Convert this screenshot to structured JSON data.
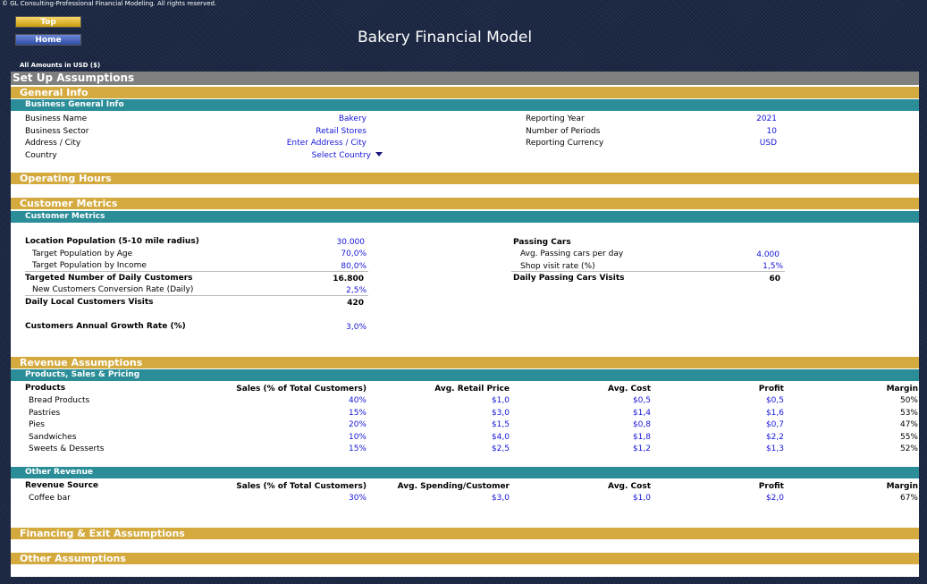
{
  "copyright": "© GL Consulting-Professional Financial Modeling. All rights reserved.",
  "nav": {
    "top_label": "Top",
    "home_label": "Home"
  },
  "title": "Bakery Financial Model",
  "amounts_note": "All Amounts in  USD ($)",
  "setup_title": "Set Up Assumptions",
  "general": {
    "section": "General Info",
    "sub": "Business General Info",
    "business_name_label": "Business Name",
    "business_name": "Bakery",
    "sector_label": "Business Sector",
    "sector": "Retail Stores",
    "address_label": "Address / City",
    "address": "Enter Address / City",
    "country_label": "Country",
    "country": "Select Country",
    "reporting_year_label": "Reporting Year",
    "reporting_year": "2021",
    "periods_label": "Number of Periods",
    "periods": "10",
    "currency_label": "Reporting Currency",
    "currency": "USD"
  },
  "operating_hours": {
    "section": "Operating Hours"
  },
  "customer": {
    "section": "Customer Metrics",
    "sub": "Customer Metrics",
    "pop_label": "Location Population (5-10 mile radius)",
    "pop": "30.000",
    "age_label": "Target Population by Age",
    "age": "70,0%",
    "income_label": "Target Population by Income",
    "income": "80,0%",
    "targeted_label": "Targeted Number of Daily Customers",
    "targeted": "16.800",
    "conv_label": "New Customers Conversion Rate (Daily)",
    "conv": "2,5%",
    "local_label": "Daily Local Customers Visits",
    "local": "420",
    "growth_label": "Customers Annual Growth Rate (%)",
    "growth": "3,0%",
    "passing_label": "Passing Cars",
    "cars_label": "Avg. Passing cars per day",
    "cars": "4.000",
    "shop_rate_label": "Shop visit rate (%)",
    "shop_rate": "1,5%",
    "cars_visits_label": "Daily Passing Cars Visits",
    "cars_visits": "60"
  },
  "revenue": {
    "section": "Revenue Assumptions",
    "sub": "Products, Sales & Pricing",
    "headers": [
      "Products",
      "Sales (% of Total Customers)",
      "Avg. Retail Price",
      "Avg. Cost",
      "Profit",
      "Margin"
    ],
    "rows": [
      {
        "name": "Bread Products",
        "sales": "40%",
        "price": "$1,0",
        "cost": "$0,5",
        "profit": "$0,5",
        "margin": "50%"
      },
      {
        "name": "Pastries",
        "sales": "15%",
        "price": "$3,0",
        "cost": "$1,4",
        "profit": "$1,6",
        "margin": "53%"
      },
      {
        "name": "Pies",
        "sales": "20%",
        "price": "$1,5",
        "cost": "$0,8",
        "profit": "$0,7",
        "margin": "47%"
      },
      {
        "name": "Sandwiches",
        "sales": "10%",
        "price": "$4,0",
        "cost": "$1,8",
        "profit": "$2,2",
        "margin": "55%"
      },
      {
        "name": "Sweets & Desserts",
        "sales": "15%",
        "price": "$2,5",
        "cost": "$1,2",
        "profit": "$1,3",
        "margin": "52%"
      }
    ],
    "other_sub": "Other Revenue",
    "other_headers": [
      "Revenue Source",
      "Sales (% of Total Customers)",
      "Avg. Spending/Customer",
      "Avg. Cost",
      "Profit",
      "Margin"
    ],
    "other_rows": [
      {
        "name": "Coffee bar",
        "sales": "30%",
        "price": "$3,0",
        "cost": "$1,0",
        "profit": "$2,0",
        "margin": "67%"
      }
    ]
  },
  "financing": {
    "section": "Financing & Exit Assumptions"
  },
  "other_assumptions": {
    "section": "Other Assumptions"
  }
}
